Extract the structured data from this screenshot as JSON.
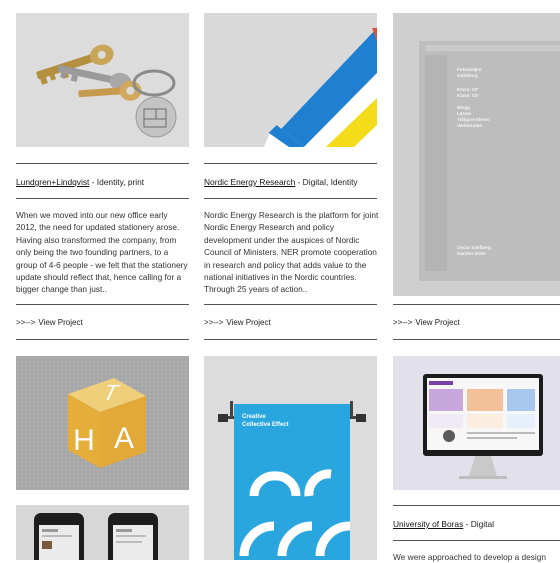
{
  "projects": [
    {
      "name": "Lundgren+Lindqvist",
      "category": " - Identity, print",
      "description": "When we moved into our new office early 2012, the need for updated stationery arose. Having also transformed the company, from only being the two founding partners, to a group of 4-6 people - we felt that the stationery update should reflect that, hence calling for a bigger change than just..",
      "cta_arrow": ">>-->",
      "cta_label": "View Project",
      "thumb_icon": "keys-image"
    },
    {
      "name": "Nordic Energy Research",
      "category": " - Digital, Identity",
      "description": "Nordic Energy Research is the platform for joint Nordic Energy Research and policy development under the auspices of Nordic Council of Ministers. NER promote cooperation in research and policy that adds value to the national initiatives in the Nordic countries. Through 25 years of action..",
      "cta_arrow": ">>-->",
      "cta_label": "View Project",
      "thumb_icon": "stripes-graphic"
    },
    {
      "cta_arrow": ">>-->",
      "cta_label": "View Project",
      "thumb_icon": "stationery-sheet",
      "sheet": {
        "lines_top": [
          "Fotoateljen",
          "Göteborg"
        ],
        "lines_mid": [
          "Klass: 03°",
          "Klass: 03°"
        ],
        "lines_list": [
          "Blogg",
          "Lärare",
          "Tidigare Elever",
          "Verktreuten"
        ],
        "lines_bottom": [
          "Oscar Sahlberg",
          "Garden State"
        ]
      }
    },
    {
      "thumb_icon": "cube-letters",
      "cube_letters": [
        "T",
        "H",
        "A"
      ]
    },
    {
      "thumb_icon": "poster-image",
      "poster_title": [
        "Creative",
        "Collective Effect"
      ]
    },
    {
      "name": "University of Boras",
      "category": " - Digital",
      "description": "We were approached to develop a design",
      "thumb_icon": "monitor-image"
    },
    {
      "thumb_icon": "phones-image"
    }
  ],
  "colors": {
    "blue": "#1f7fd1",
    "yellow": "#f4dc1b",
    "cube_yellow": "#e9b63c",
    "poster_blue": "#2aa6df"
  }
}
